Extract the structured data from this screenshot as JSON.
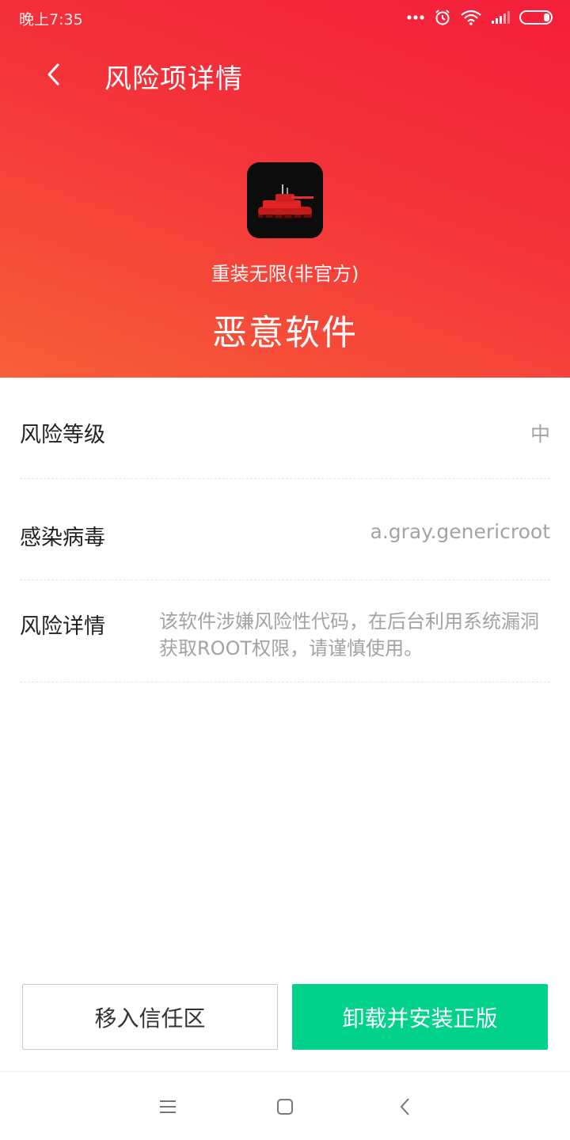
{
  "status_bar": {
    "time": "晚上7:35",
    "icons": [
      "more-dots-icon",
      "alarm-icon",
      "wifi-icon",
      "signal-icon",
      "battery-icon"
    ]
  },
  "header": {
    "title": "风险项详情",
    "back_icon": "back-arrow-icon"
  },
  "app": {
    "name": "重装无限(非官方)",
    "icon": "tank-game-app-icon",
    "risk_type": "恶意软件"
  },
  "details": [
    {
      "label": "风险等级",
      "value": "中"
    },
    {
      "label": "感染病毒",
      "value": "a.gray.genericroot"
    },
    {
      "label": "风险详情",
      "value": "该软件涉嫌风险性代码，在后台利用系统漏洞获取ROOT权限，请谨慎使用。"
    }
  ],
  "actions": {
    "trust_label": "移入信任区",
    "uninstall_label": "卸载并安装正版"
  },
  "nav": {
    "items": [
      "menu-icon",
      "home-icon",
      "back-icon"
    ]
  },
  "colors": {
    "header_gradient_start": "#f41e3a",
    "header_gradient_end": "#f75f38",
    "primary_button": "#00d28c",
    "secondary_text": "#a3a3a3"
  }
}
